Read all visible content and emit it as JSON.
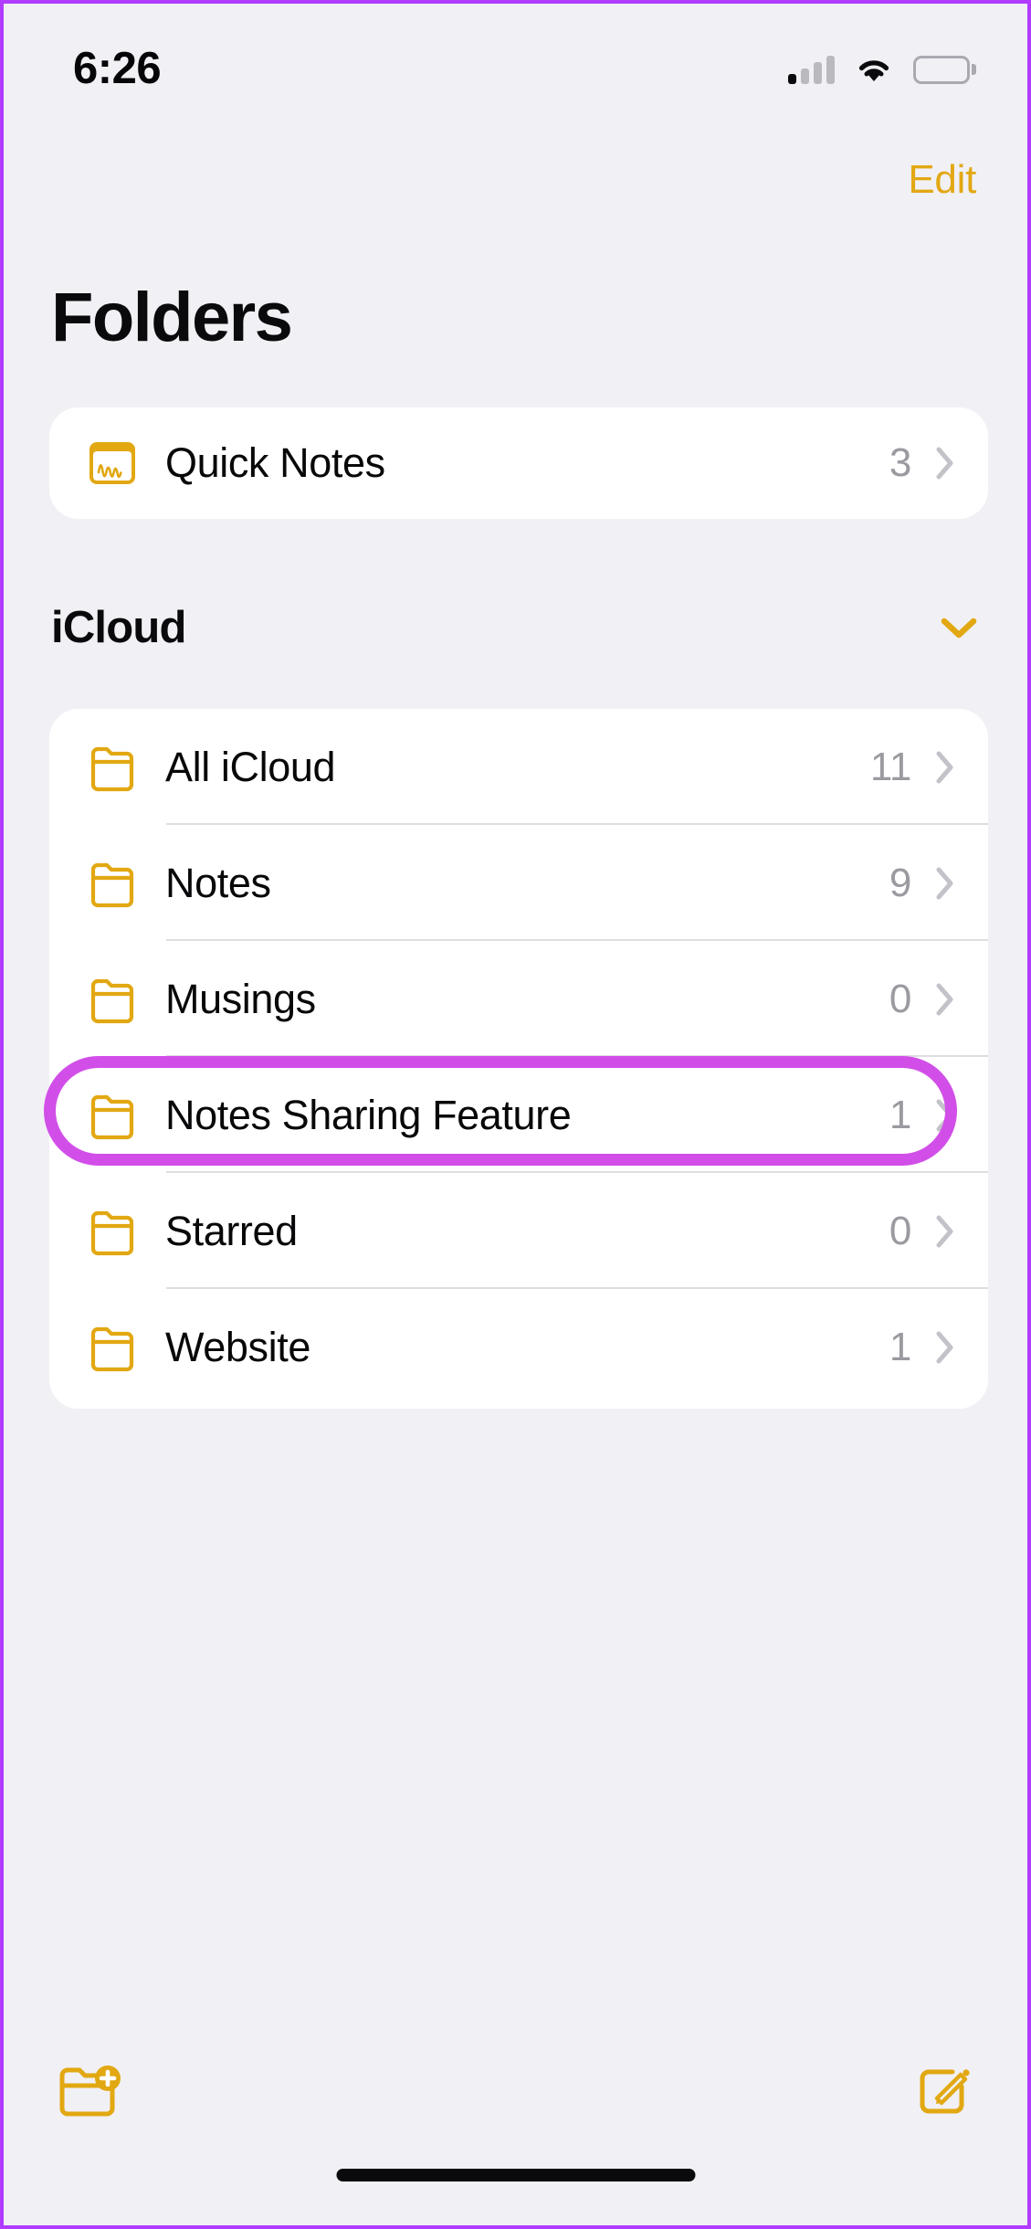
{
  "colors": {
    "accent": "#E2A812",
    "background": "#F1F0F5",
    "card": "#FFFFFF",
    "highlight": "#D14FE8",
    "border": "#B13BFF",
    "count_text": "#9A9AA0",
    "primary_text": "#08080A"
  },
  "status_bar": {
    "time": "6:26",
    "signal_icon": "cellular-signal-icon",
    "signal_bars_active": 1,
    "signal_bars_total": 4,
    "wifi_icon": "wifi-icon",
    "battery_icon": "battery-full-icon"
  },
  "nav": {
    "edit_label": "Edit"
  },
  "header": {
    "title": "Folders"
  },
  "quick_notes": {
    "label": "Quick Notes",
    "count": "3",
    "icon": "quick-note-scribble-icon",
    "chevron": "chevron-right-icon"
  },
  "icloud_section": {
    "title": "iCloud",
    "toggle_icon": "chevron-down-icon",
    "folders": [
      {
        "label": "All iCloud",
        "count": "11",
        "icon": "folder-icon",
        "highlighted": false
      },
      {
        "label": "Notes",
        "count": "9",
        "icon": "folder-icon",
        "highlighted": false
      },
      {
        "label": "Musings",
        "count": "0",
        "icon": "folder-icon",
        "highlighted": false
      },
      {
        "label": "Notes Sharing Feature",
        "count": "1",
        "icon": "folder-icon",
        "highlighted": true
      },
      {
        "label": "Starred",
        "count": "0",
        "icon": "folder-icon",
        "highlighted": false
      },
      {
        "label": "Website",
        "count": "1",
        "icon": "folder-icon",
        "highlighted": false
      }
    ]
  },
  "toolbar": {
    "new_folder_icon": "new-folder-icon",
    "compose_icon": "compose-note-icon"
  },
  "home_indicator": "home-indicator"
}
